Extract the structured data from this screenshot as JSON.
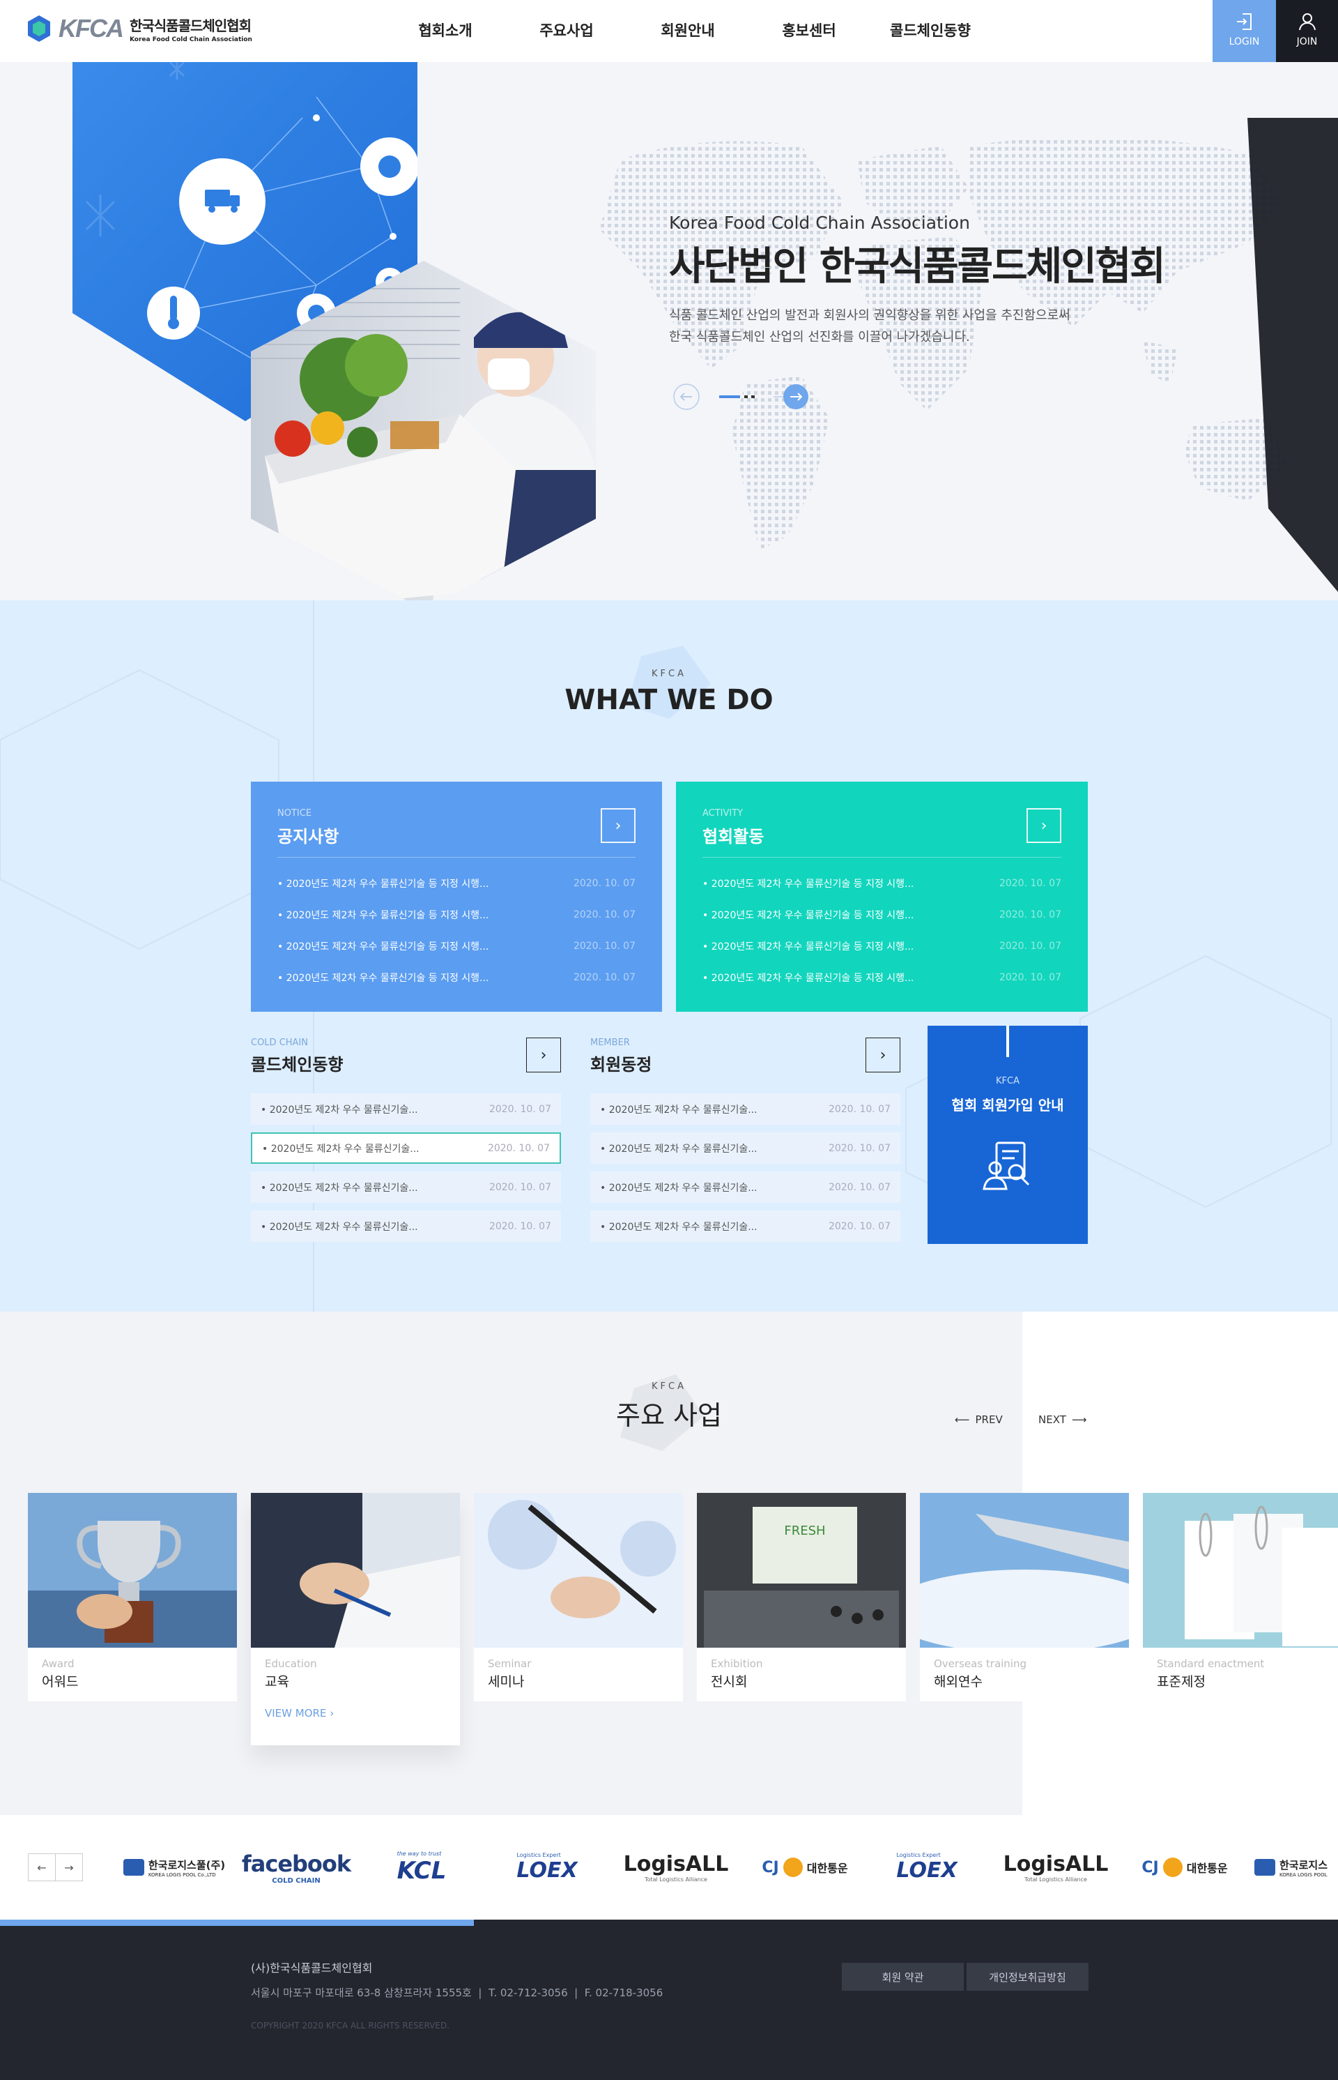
{
  "header": {
    "logo_brand": "KFCA",
    "logo_ko": "한국식품콜드체인협회",
    "logo_en": "Korea Food Cold Chain Association",
    "nav": [
      "협회소개",
      "주요사업",
      "회원안내",
      "홍보센터",
      "콜드체인동향"
    ],
    "login_label": "LOGIN",
    "join_label": "JOIN",
    "colors": {
      "login_bg": "#6fa6ec",
      "join_bg": "#1a1c23"
    }
  },
  "hero": {
    "subtitle": "Korea Food Cold Chain Association",
    "title": "사단법인 한국식품콜드체인협회",
    "desc_line1": "식품 콜드체인 산업의 발전과 회원사의 권익향상을 위한 사업을 추진함으로써",
    "desc_line2": "한국 식품콜드체인 산업의 선진화를 이끌어 나가겠습니다."
  },
  "what_we_do": {
    "tag": "KFCA",
    "title": "WHAT WE DO",
    "notice": {
      "tag": "NOTICE",
      "title": "공지사항",
      "color": "#5b9df0",
      "items": [
        {
          "text": "2020년도 제2차 우수 물류신기술 등 지정 시행...",
          "date": "2020. 10. 07"
        },
        {
          "text": "2020년도 제2차 우수 물류신기술 등 지정 시행...",
          "date": "2020. 10. 07"
        },
        {
          "text": "2020년도 제2차 우수 물류신기술 등 지정 시행...",
          "date": "2020. 10. 07"
        },
        {
          "text": "2020년도 제2차 우수 물류신기술 등 지정 시행...",
          "date": "2020. 10. 07"
        }
      ]
    },
    "activity": {
      "tag": "ACTIVITY",
      "title": "협회활동",
      "color": "#12d5bd",
      "items": [
        {
          "text": "2020년도 제2차 우수 물류신기술 등 지정 시행...",
          "date": "2020. 10. 07"
        },
        {
          "text": "2020년도 제2차 우수 물류신기술 등 지정 시행...",
          "date": "2020. 10. 07"
        },
        {
          "text": "2020년도 제2차 우수 물류신기술 등 지정 시행...",
          "date": "2020. 10. 07"
        },
        {
          "text": "2020년도 제2차 우수 물류신기술 등 지정 시행...",
          "date": "2020. 10. 07"
        }
      ]
    },
    "coldchain": {
      "tag": "COLD CHAIN",
      "title": "콜드체인동향",
      "items": [
        {
          "text": "2020년도 제2차 우수 물류신기술...",
          "date": "2020. 10. 07"
        },
        {
          "text": "2020년도 제2차 우수 물류신기술...",
          "date": "2020. 10. 07"
        },
        {
          "text": "2020년도 제2차 우수 물류신기술...",
          "date": "2020. 10. 07"
        },
        {
          "text": "2020년도 제2차 우수 물류신기술...",
          "date": "2020. 10. 07"
        }
      ]
    },
    "member": {
      "tag": "MEMBER",
      "title": "회원동정",
      "items": [
        {
          "text": "2020년도 제2차 우수 물류신기술...",
          "date": "2020. 10. 07"
        },
        {
          "text": "2020년도 제2차 우수 물류신기술...",
          "date": "2020. 10. 07"
        },
        {
          "text": "2020년도 제2차 우수 물류신기술...",
          "date": "2020. 10. 07"
        },
        {
          "text": "2020년도 제2차 우수 물류신기술...",
          "date": "2020. 10. 07"
        }
      ]
    },
    "join_card": {
      "tag": "KFCA",
      "title": "협회 회원가입 안내",
      "color": "#1866d6"
    }
  },
  "business": {
    "tag": "KFCA",
    "title": "주요 사업",
    "prev_label": "PREV",
    "next_label": "NEXT",
    "cards": [
      {
        "en": "Award",
        "ko": "어워드"
      },
      {
        "en": "Education",
        "ko": "교육",
        "more": "VIEW MORE"
      },
      {
        "en": "Seminar",
        "ko": "세미나"
      },
      {
        "en": "Exhibition",
        "ko": "전시회"
      },
      {
        "en": "Overseas training",
        "ko": "해외연수"
      },
      {
        "en": "Standard enactment",
        "ko": "표준제정"
      }
    ]
  },
  "partners": {
    "logos": [
      {
        "name": "한국로지스풀(주)",
        "sub": "KOREA LOGIS POOL Co.,LTD"
      },
      {
        "name": "facebook",
        "sub": "COLD CHAIN"
      },
      {
        "name": "KCL",
        "sub": "the way to trust"
      },
      {
        "name": "LOEX",
        "sub": "Logistics Expert"
      },
      {
        "name": "LogisALL",
        "sub": "Total Logistics Alliance"
      },
      {
        "name": "대한통운",
        "sub": "CJ"
      },
      {
        "name": "LOEX",
        "sub": "Logistics Expert"
      },
      {
        "name": "LogisALL",
        "sub": "Total Logistics Alliance"
      },
      {
        "name": "대한통운",
        "sub": "CJ"
      },
      {
        "name": "한국로지스",
        "sub": "KOREA LOGIS POOL"
      }
    ]
  },
  "footer": {
    "org": "(사)한국식품콜드체인협회",
    "address": "서울시 마포구 마포대로 63-8 삼창프라자 1555호",
    "tel": "T. 02-712-3056",
    "fax": "F. 02-718-3056",
    "copyright": "COPYRIGHT 2020 KFCA ALL RIGHTS RESERVED.",
    "terms_label": "회원 약관",
    "privacy_label": "개인정보취급방침"
  }
}
